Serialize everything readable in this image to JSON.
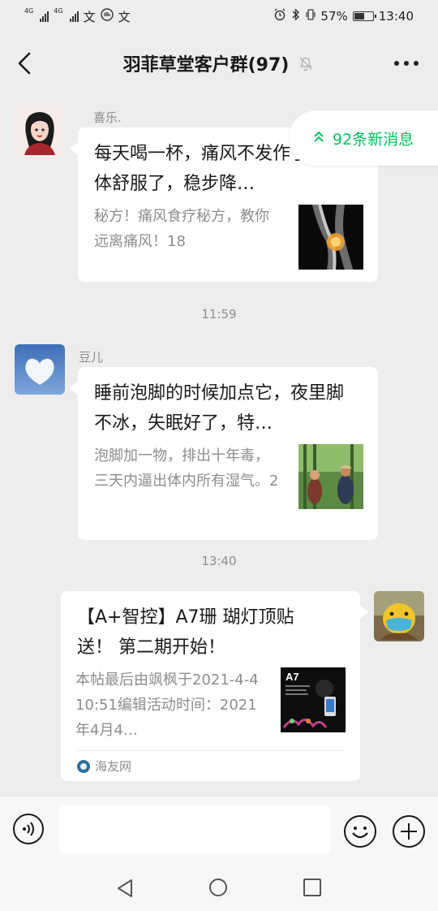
{
  "status_bar": {
    "net1": "4G",
    "net2": "4G",
    "notif_icons": [
      "文",
      "文"
    ],
    "battery_percent": "57%",
    "battery_level": 0.57,
    "time": "13:40"
  },
  "header": {
    "title": "羽菲草堂客户群(97)"
  },
  "new_messages": {
    "label": "92条新消息"
  },
  "messages": [
    {
      "sender": "喜乐.",
      "title": "每天喝一杯，痛风不发作了，身体舒服了，稳步降…",
      "desc": "秘方！痛风食疗秘方，教你远离痛风！18"
    },
    {
      "time": "11:59"
    },
    {
      "sender": "豆儿",
      "title": "睡前泡脚的时候加点它，夜里脚不冰，失眠好了，特…",
      "desc": "泡脚加一物，排出十年毒，三天内逼出体内所有湿气。2"
    },
    {
      "time": "13:40"
    },
    {
      "title": "【A+智控】A7珊 瑚灯顶贴送！ 第二期开始！",
      "desc": "本帖最后由飒枫于2021-4-410:51编辑活动时间：2021年4月4…",
      "source": "海友网",
      "thumb_text": "A7"
    }
  ],
  "colors": {
    "accent": "#07c160",
    "background": "#ededed"
  }
}
